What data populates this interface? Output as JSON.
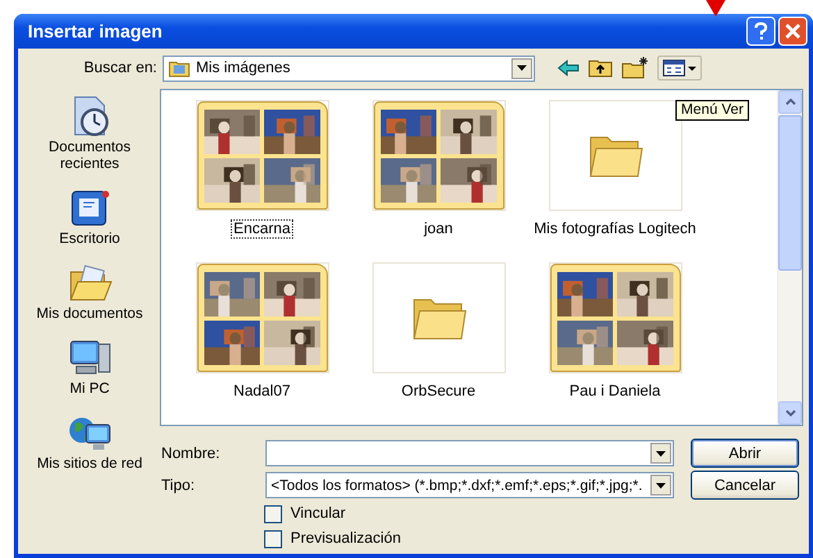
{
  "window": {
    "title": "Insertar imagen"
  },
  "look_in": {
    "label": "Buscar en:",
    "value": "Mis imágenes"
  },
  "tooltip": "Menú Ver",
  "places": [
    {
      "label": "Documentos recientes",
      "kind": "recent"
    },
    {
      "label": "Escritorio",
      "kind": "desktop"
    },
    {
      "label": "Mis documentos",
      "kind": "documents"
    },
    {
      "label": "Mi PC",
      "kind": "computer"
    },
    {
      "label": "Mis sitios de red",
      "kind": "network"
    }
  ],
  "items": [
    {
      "name": "Encarna",
      "kind": "photos",
      "focused": true
    },
    {
      "name": "joan",
      "kind": "photos",
      "focused": false
    },
    {
      "name": "Mis fotografías Logitech",
      "kind": "empty",
      "focused": false
    },
    {
      "name": "Nadal07",
      "kind": "photos",
      "focused": false
    },
    {
      "name": "OrbSecure",
      "kind": "empty",
      "focused": false
    },
    {
      "name": "Pau i Daniela",
      "kind": "photos",
      "focused": false
    }
  ],
  "file_name": {
    "label": "Nombre:"
  },
  "file_type": {
    "label": "Tipo:",
    "value": "<Todos los formatos> (*.bmp;*.dxf;*.emf;*.eps;*.gif;*.jpg;*."
  },
  "options": [
    {
      "label": "Vincular",
      "checked": false
    },
    {
      "label": "Previsualización",
      "checked": false
    }
  ],
  "buttons": [
    {
      "label": "Abrir",
      "default": true
    },
    {
      "label": "Cancelar",
      "default": false
    }
  ]
}
